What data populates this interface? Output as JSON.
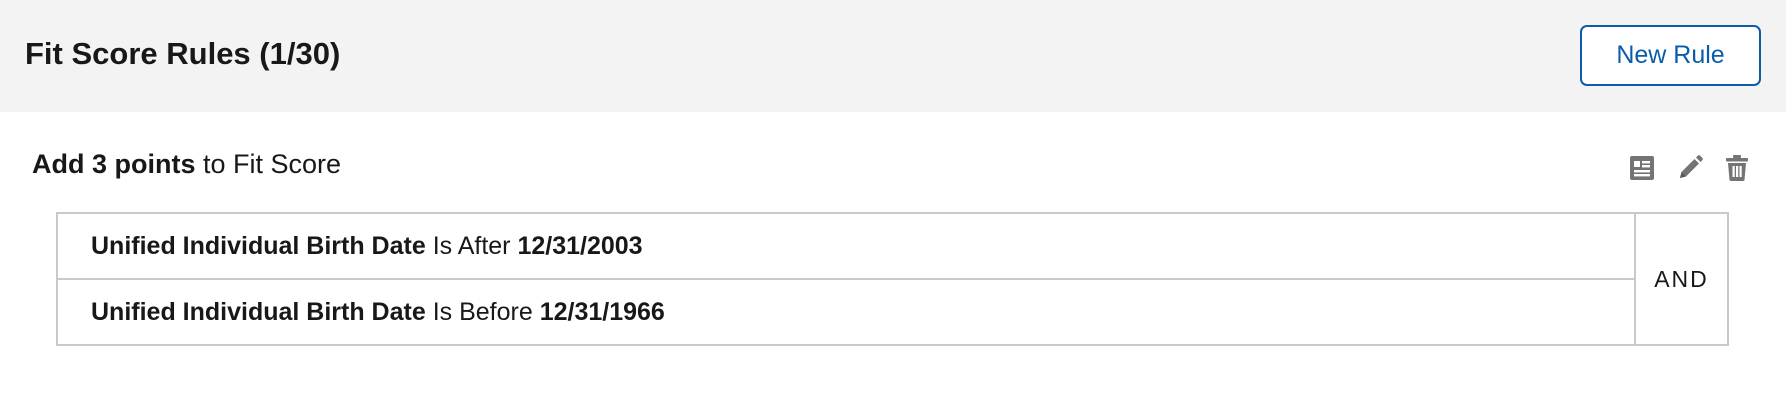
{
  "header": {
    "title": "Fit Score Rules (1/30)",
    "new_rule_label": "New Rule"
  },
  "rule": {
    "action_bold": "Add 3 points",
    "action_rest": " to Fit Score",
    "icons": [
      "details-icon",
      "edit-icon",
      "delete-icon"
    ],
    "operator": "AND",
    "conditions": [
      {
        "field": "Unified Individual Birth Date",
        "op": " Is After ",
        "value": "12/31/2003"
      },
      {
        "field": "Unified Individual Birth Date",
        "op": " Is Before ",
        "value": "12/31/1966"
      }
    ]
  },
  "colors": {
    "header_bg": "#f3f3f3",
    "brand_blue": "#0b5cab",
    "border": "#c9c9c9",
    "icon_gray": "#747474"
  }
}
